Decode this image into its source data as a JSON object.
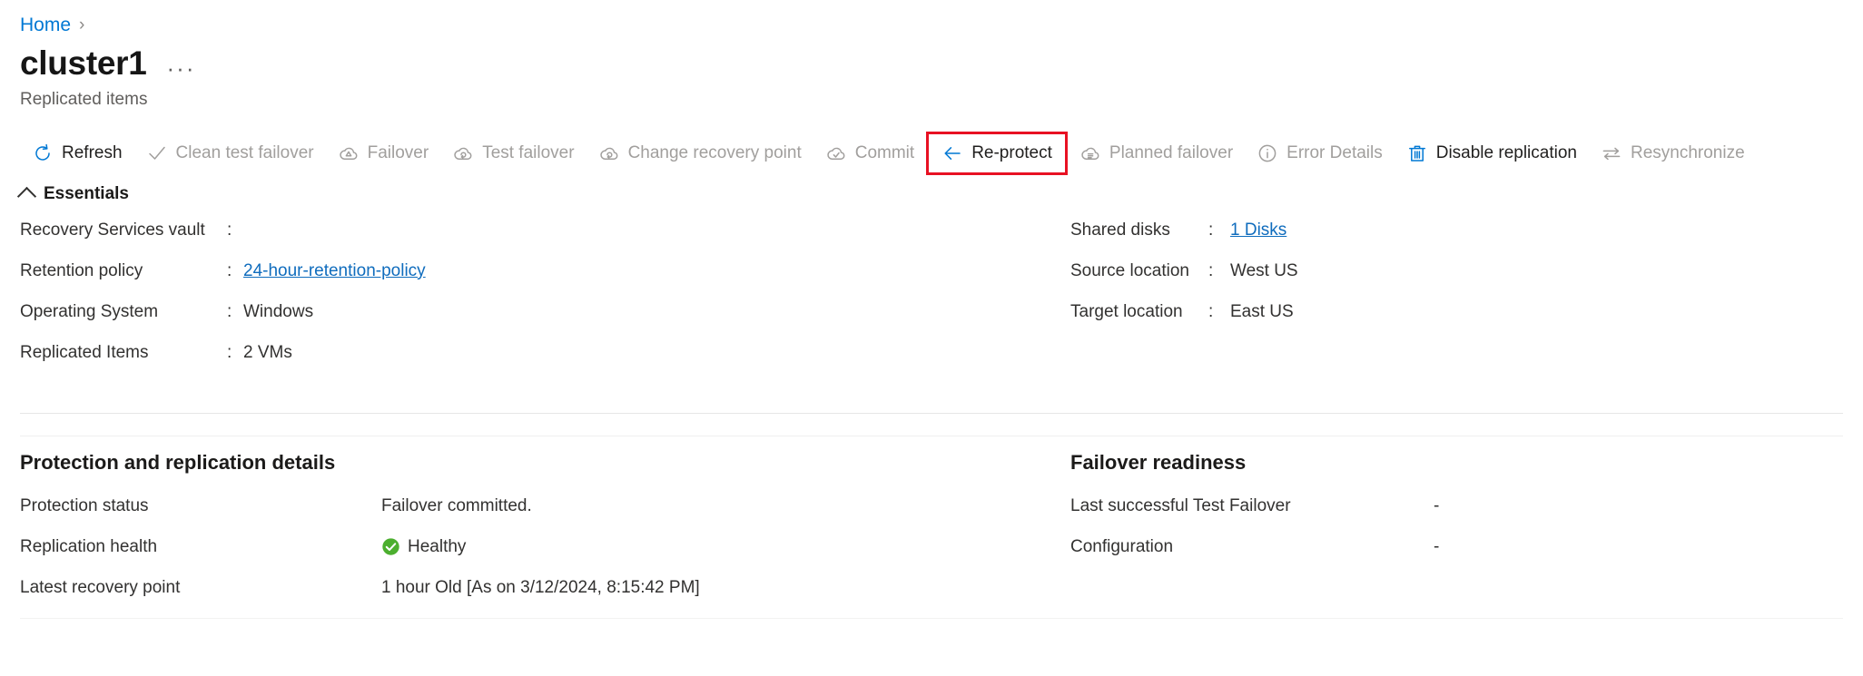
{
  "breadcrumb": {
    "home_label": "Home",
    "separator": "›"
  },
  "header": {
    "title": "cluster1",
    "ellipsis": "···",
    "subtitle": "Replicated items"
  },
  "commandbar": {
    "items": [
      {
        "label": "Refresh",
        "icon": "refresh-icon",
        "state": "enabled",
        "icon_color": "#0078d4",
        "highlighted": false
      },
      {
        "label": "Clean test failover",
        "icon": "checkmark-icon",
        "state": "disabled",
        "icon_color": "#a19f9d",
        "highlighted": false
      },
      {
        "label": "Failover",
        "icon": "cloud-failover-icon",
        "state": "disabled",
        "icon_color": "#a19f9d",
        "highlighted": false
      },
      {
        "label": "Test failover",
        "icon": "cloud-test-failover-icon",
        "state": "disabled",
        "icon_color": "#a19f9d",
        "highlighted": false
      },
      {
        "label": "Change recovery point",
        "icon": "cloud-recovery-point-icon",
        "state": "disabled",
        "icon_color": "#a19f9d",
        "highlighted": false
      },
      {
        "label": "Commit",
        "icon": "cloud-commit-icon",
        "state": "disabled",
        "icon_color": "#a19f9d",
        "highlighted": false
      },
      {
        "label": "Re-protect",
        "icon": "arrow-left-icon",
        "state": "enabled",
        "icon_color": "#0078d4",
        "highlighted": true
      },
      {
        "label": "Planned failover",
        "icon": "cloud-planned-failover-icon",
        "state": "disabled",
        "icon_color": "#a19f9d",
        "highlighted": false
      },
      {
        "label": "Error Details",
        "icon": "info-icon",
        "state": "disabled",
        "icon_color": "#a19f9d",
        "highlighted": false
      },
      {
        "label": "Disable replication",
        "icon": "trash-icon",
        "state": "enabled",
        "icon_color": "#0078d4",
        "highlighted": false
      },
      {
        "label": "Resynchronize",
        "icon": "resync-icon",
        "state": "disabled",
        "icon_color": "#a19f9d",
        "highlighted": false
      }
    ],
    "highlight_color": "#e81123"
  },
  "essentials": {
    "heading": "Essentials",
    "left": [
      {
        "label": "Recovery Services vault",
        "colon": ":",
        "value": "",
        "link": false
      },
      {
        "label": "Retention policy",
        "colon": ":",
        "value": "24-hour-retention-policy",
        "link": true
      },
      {
        "label": "Operating System",
        "colon": ":",
        "value": "Windows",
        "link": false
      },
      {
        "label": "Replicated Items",
        "colon": ":",
        "value": "2 VMs",
        "link": false
      }
    ],
    "right": [
      {
        "label": "Shared disks",
        "colon": ":",
        "value": "1 Disks",
        "link": true
      },
      {
        "label": "Source location",
        "colon": ":",
        "value": "West US",
        "link": false
      },
      {
        "label": "Target location",
        "colon": ":",
        "value": "East US",
        "link": false
      }
    ]
  },
  "protection": {
    "title": "Protection and replication details",
    "rows": [
      {
        "key": "Protection status",
        "value": "Failover committed.",
        "icon": ""
      },
      {
        "key": "Replication health",
        "value": "Healthy",
        "icon": "health-ok-icon"
      },
      {
        "key": "Latest recovery point",
        "value": "1 hour Old [As on 3/12/2024, 8:15:42 PM]",
        "icon": ""
      }
    ],
    "health_color": "#4caf2f"
  },
  "failover_readiness": {
    "title": "Failover readiness",
    "rows": [
      {
        "key": "Last successful Test Failover",
        "value": "-"
      },
      {
        "key": "Configuration",
        "value": "-"
      }
    ]
  },
  "colors": {
    "link": "#0078d4",
    "accent": "#0f6cbd",
    "text": "#1b1a19",
    "muted": "#605e5c",
    "disabled": "#a19f9d",
    "divider": "#e6e6e6"
  }
}
